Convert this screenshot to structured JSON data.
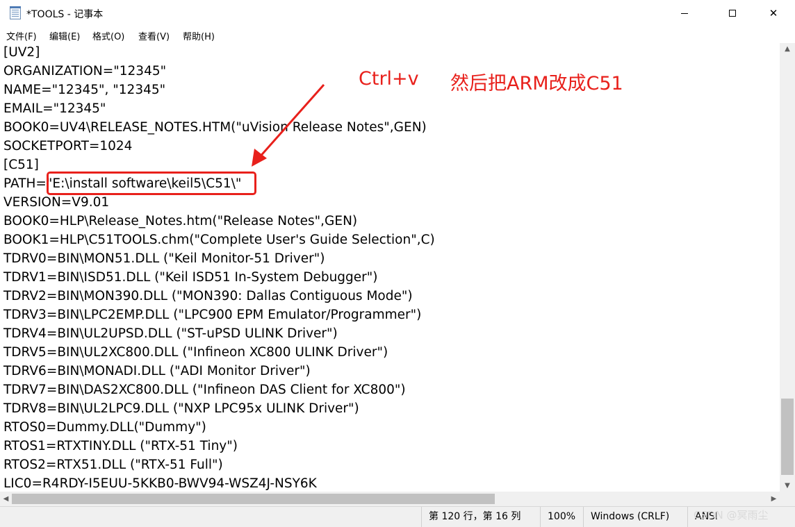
{
  "window": {
    "title": "*TOOLS - 记事本",
    "controls": {
      "minimize": "–",
      "maximize": "□",
      "close": "✕"
    }
  },
  "menu": [
    "文件(F)",
    "编辑(E)",
    "格式(O)",
    "查看(V)",
    "帮助(H)"
  ],
  "editor": {
    "lines": [
      "[UV2]",
      "ORGANIZATION=\"12345\"",
      "NAME=\"12345\", \"12345\"",
      "EMAIL=\"12345\"",
      "BOOK0=UV4\\RELEASE_NOTES.HTM(\"uVision Release Notes\",GEN)",
      "SOCKETPORT=1024",
      "[C51]",
      "PATH=\"E:\\install software\\keil5\\C51\\\"",
      "VERSION=V9.01",
      "BOOK0=HLP\\Release_Notes.htm(\"Release Notes\",GEN)",
      "BOOK1=HLP\\C51TOOLS.chm(\"Complete User's Guide Selection\",C)",
      "TDRV0=BIN\\MON51.DLL (\"Keil Monitor-51 Driver\")",
      "TDRV1=BIN\\ISD51.DLL (\"Keil ISD51 In-System Debugger\")",
      "TDRV2=BIN\\MON390.DLL (\"MON390: Dallas Contiguous Mode\")",
      "TDRV3=BIN\\LPC2EMP.DLL (\"LPC900 EPM Emulator/Programmer\")",
      "TDRV4=BIN\\UL2UPSD.DLL (\"ST-uPSD ULINK Driver\")",
      "TDRV5=BIN\\UL2XC800.DLL (\"Infineon XC800 ULINK Driver\")",
      "TDRV6=BIN\\MONADI.DLL (\"ADI Monitor Driver\")",
      "TDRV7=BIN\\DAS2XC800.DLL (\"Infineon DAS Client for XC800\")",
      "TDRV8=BIN\\UL2LPC9.DLL (\"NXP LPC95x ULINK Driver\")",
      "RTOS0=Dummy.DLL(\"Dummy\")",
      "RTOS1=RTXTINY.DLL (\"RTX-51 Tiny\")",
      "RTOS2=RTX51.DLL (\"RTX-51 Full\")",
      "LIC0=R4RDY-I5EUU-5KKB0-BWV94-WSZ4J-NSY6K"
    ]
  },
  "annotation": {
    "instruction_1": "Ctrl+v",
    "instruction_2": "然后把ARM改成C51",
    "color": "#e8201b"
  },
  "statusbar": {
    "position": "第 120 行，第 16 列",
    "zoom": "100%",
    "line_ending": "Windows (CRLF)",
    "encoding": "ANSI"
  },
  "watermark": "CSDN @冥雨尘"
}
